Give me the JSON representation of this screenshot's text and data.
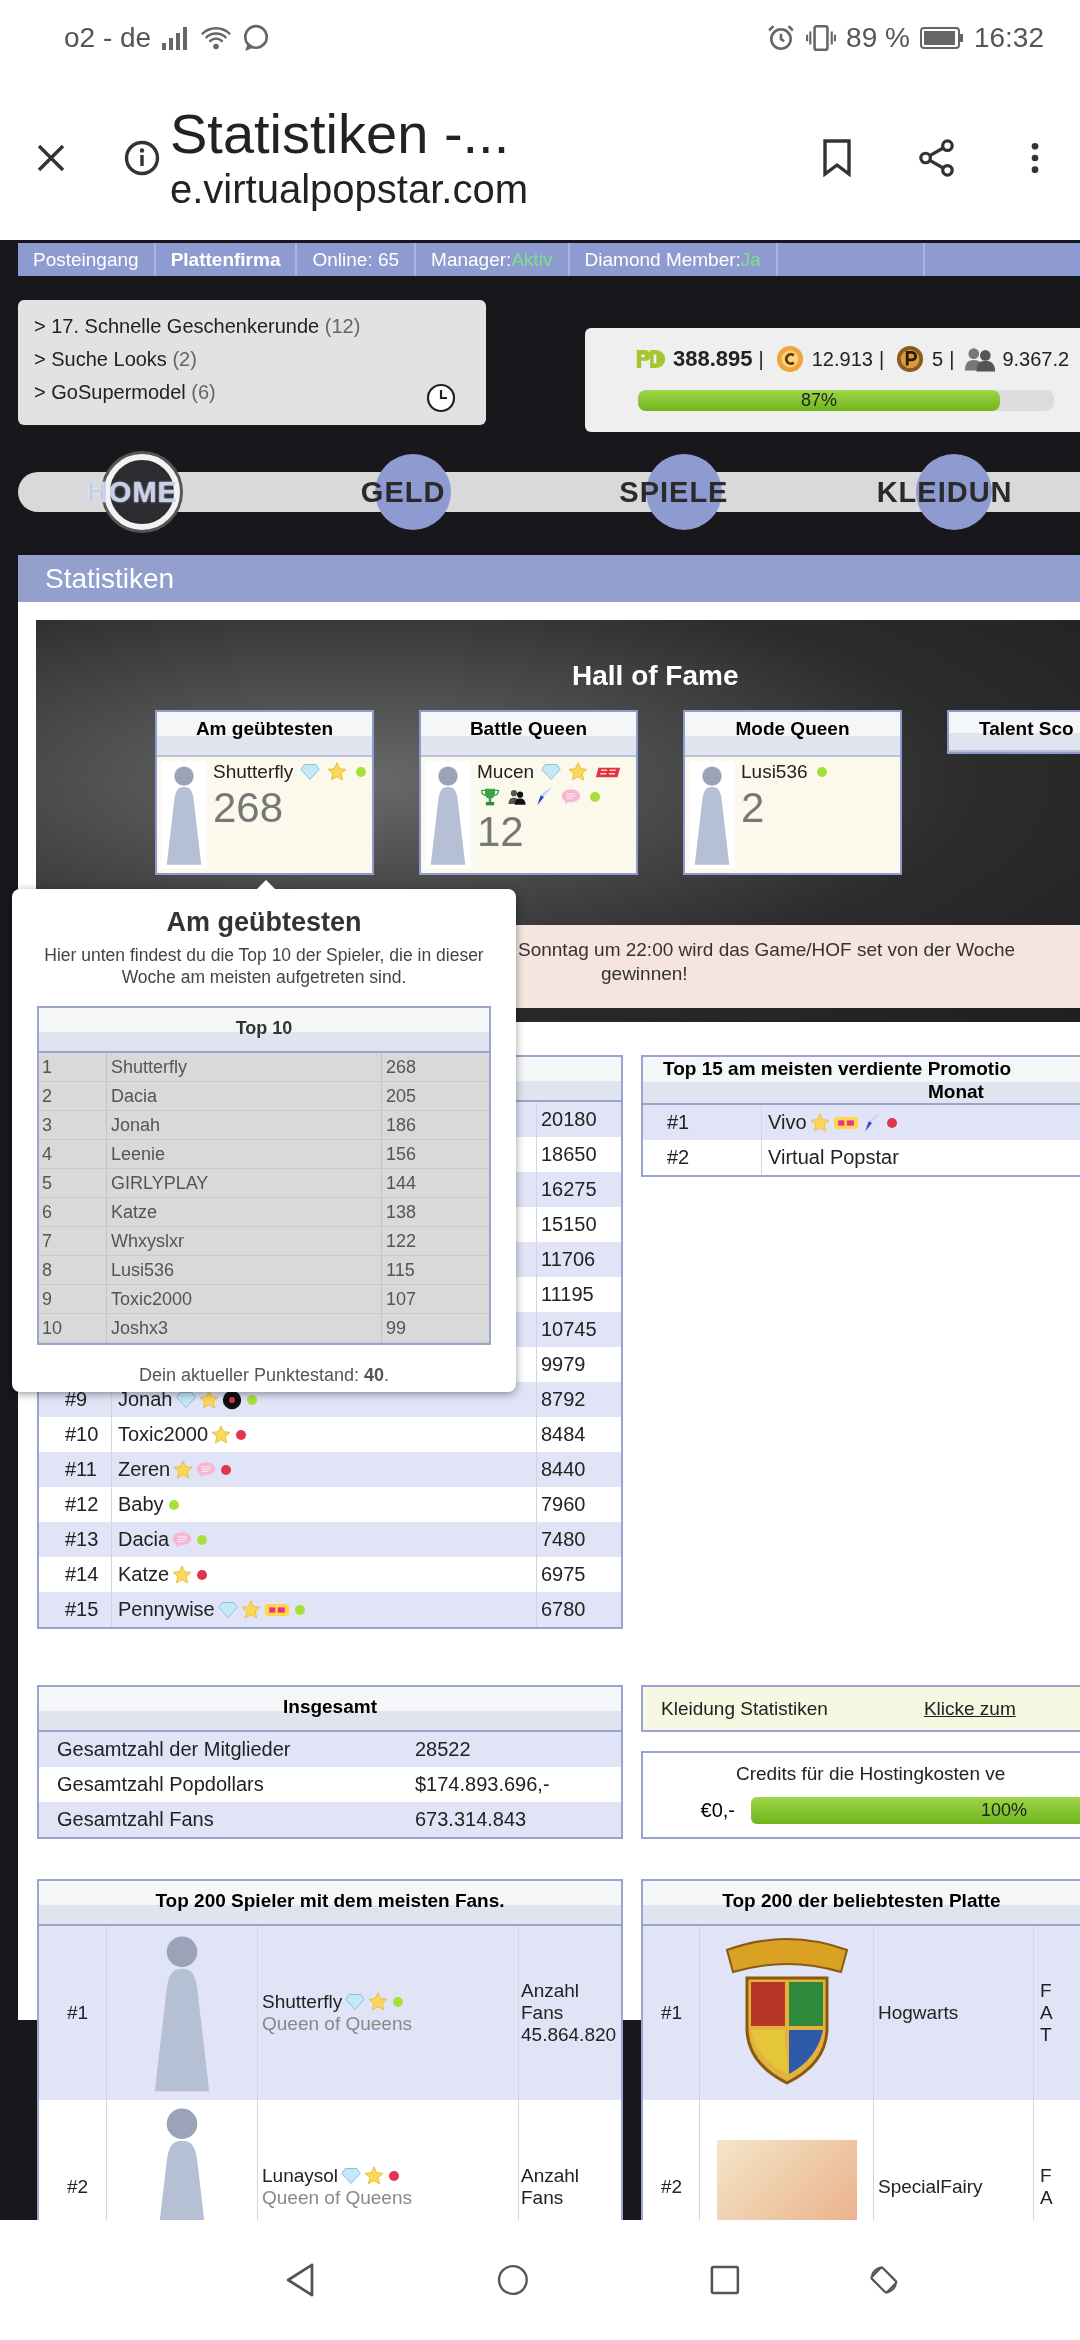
{
  "status_bar": {
    "carrier": "o2 - de",
    "battery": "89 %",
    "time": "16:32"
  },
  "browser": {
    "title": "Statistiken -...",
    "url": "e.virtualpopstar.com"
  },
  "top_nav": [
    {
      "label": "Posteingang",
      "selected": false
    },
    {
      "label": "Plattenfirma",
      "selected": true
    },
    {
      "label": "Online: 65",
      "selected": false
    },
    {
      "label": "Manager:",
      "value": "Aktiv",
      "selected": false
    },
    {
      "label": "Diamond Member:",
      "value": "Ja",
      "selected": false
    }
  ],
  "notifications": [
    {
      "label": "> 17. Schnelle Geschenkerunde",
      "count": "(12)"
    },
    {
      "label": "> Suche Looks",
      "count": "(2)"
    },
    {
      "label": "> GoSupermodel",
      "count": "(6)"
    }
  ],
  "balance": {
    "items": [
      {
        "kind": "popdollars",
        "value": "388.895",
        "separator": "|"
      },
      {
        "kind": "coins",
        "value": "12.913",
        "separator": "|"
      },
      {
        "kind": "points",
        "value": "5",
        "separator": "|"
      },
      {
        "kind": "fans",
        "value": "9.367.2"
      }
    ],
    "level": 0.87,
    "label": "87%"
  },
  "menu": [
    {
      "label": "HOME",
      "selected": true
    },
    {
      "label": "GELD",
      "selected": false
    },
    {
      "label": "SPIELE",
      "selected": false
    },
    {
      "label": "KLEIDUN",
      "selected": false
    }
  ],
  "section_title": "Statistiken",
  "hall_of_fame": {
    "title": "Hall of Fame",
    "cards": [
      {
        "title": "Am geübtesten",
        "player": "Shutterfly",
        "badges": [
          {
            "kind": "diamond"
          },
          {
            "kind": "star"
          }
        ],
        "color": "#a8e03a",
        "score": "268"
      },
      {
        "title": "Battle Queen",
        "player": "Mucen",
        "badges": [
          {
            "kind": "diamond"
          },
          {
            "kind": "star"
          },
          {
            "kind": "nt"
          },
          {
            "kind": "trophy"
          },
          {
            "kind": "team"
          },
          {
            "kind": "quill"
          },
          {
            "kind": "chat"
          }
        ],
        "color": "#a8e03a",
        "score": "12"
      },
      {
        "title": "Mode Queen",
        "player": "Lusi536",
        "color": "#a8e03a",
        "score": "2"
      },
      {
        "title": "Talent Sco"
      }
    ],
    "notice": [
      "Sonntag um 22:00 wird das Game/HOF set von der Woche",
      "gewinnen!"
    ]
  },
  "tooltip": {
    "title": "Am geübtesten",
    "description": "Hier unten findest du die Top 10 der Spieler, die in dieser Woche am meisten aufgetreten sind.",
    "table_title": "Top 10",
    "rows": [
      {
        "rank": "1",
        "name": "Shutterfly",
        "score": "268"
      },
      {
        "rank": "2",
        "name": "Dacia",
        "score": "205"
      },
      {
        "rank": "3",
        "name": "Jonah",
        "score": "186"
      },
      {
        "rank": "4",
        "name": "Leenie",
        "score": "156"
      },
      {
        "rank": "5",
        "name": "GIRLYPLAY",
        "score": "144"
      },
      {
        "rank": "6",
        "name": "Katze",
        "score": "138"
      },
      {
        "rank": "7",
        "name": "Whxyslxr",
        "score": "122"
      },
      {
        "rank": "8",
        "name": "Lusi536",
        "score": "115"
      },
      {
        "rank": "9",
        "name": "Toxic2000",
        "score": "107"
      },
      {
        "rank": "10",
        "name": "Joshx3",
        "score": "99"
      }
    ],
    "footer": "Dein aktueller Punktestand: **40**."
  },
  "weekly_ranking": {
    "rows": [
      {
        "value": "20180"
      },
      {
        "value": "18650"
      },
      {
        "value": "16275"
      },
      {
        "value": "15150"
      },
      {
        "value": "11706"
      },
      {
        "value": "11195"
      },
      {
        "value": "10745"
      },
      {
        "value": "9979"
      },
      {
        "rank": "#9",
        "name": "Jonah",
        "badges": [
          {
            "kind": "diamond"
          },
          {
            "kind": "star"
          },
          {
            "kind": "record"
          }
        ],
        "color": "#a8e03a",
        "value": "8792"
      },
      {
        "rank": "#10",
        "name": "Toxic2000",
        "badges": [
          {
            "kind": "star"
          }
        ],
        "color": "#e0344f",
        "value": "8484"
      },
      {
        "rank": "#11",
        "name": "Zeren",
        "badges": [
          {
            "kind": "star"
          },
          {
            "kind": "chat"
          }
        ],
        "color": "#e0344f",
        "value": "8440"
      },
      {
        "rank": "#12",
        "name": "Baby",
        "color": "#a8e03a",
        "value": "7960"
      },
      {
        "rank": "#13",
        "name": "Dacia",
        "badges": [
          {
            "kind": "chat"
          }
        ],
        "color": "#a8e03a",
        "value": "7480"
      },
      {
        "rank": "#14",
        "name": "Katze",
        "badges": [
          {
            "kind": "star"
          }
        ],
        "color": "#e0344f",
        "value": "6975"
      },
      {
        "rank": "#15",
        "name": "Pennywise",
        "badges": [
          {
            "kind": "diamond"
          },
          {
            "kind": "star"
          },
          {
            "kind": "pt"
          }
        ],
        "color": "#a8e03a",
        "value": "6780"
      }
    ]
  },
  "promotion_ranking": {
    "title_lines": [
      "Top 15 am meisten verdiente Promotio",
      "Monat"
    ],
    "rows": [
      {
        "rank": "#1",
        "name": "Vivo",
        "badges": [
          {
            "kind": "star"
          },
          {
            "kind": "pt"
          },
          {
            "kind": "quill"
          }
        ],
        "color": "#e0344f"
      },
      {
        "rank": "#2",
        "name": "Virtual Popstar"
      }
    ]
  },
  "totals": {
    "title": "Insgesamt",
    "rows": [
      {
        "label": "Gesamtzahl der Mitglieder",
        "value": "28522"
      },
      {
        "label": "Gesamtzahl Popdollars",
        "value": "$174.893.696,-"
      },
      {
        "label": "Gesamtzahl Fans",
        "value": "673.314.843"
      }
    ]
  },
  "clothing_stats": {
    "label": "Kleidung Statistiken",
    "link": "Klicke zum"
  },
  "hosting": {
    "title": "Credits für die Hostingkosten ve",
    "amount": "€0,-",
    "level": 1,
    "label": "100%"
  },
  "top_players": {
    "title": "Top 200 Spieler mit dem meisten Fans.",
    "rows": [
      {
        "rank": "#1",
        "name": "Shutterfly",
        "badges": [
          {
            "kind": "diamond"
          },
          {
            "kind": "star"
          }
        ],
        "color": "#a8e03a",
        "rank_title": "Queen of Queens",
        "fans_label": "Anzahl Fans",
        "fans": "45.864.820"
      },
      {
        "rank": "#2",
        "name": "Lunaysol",
        "badges": [
          {
            "kind": "diamond"
          },
          {
            "kind": "star"
          }
        ],
        "color": "#e0344f",
        "rank_title": "Queen of Queens",
        "fans_label": "Anzahl Fans"
      }
    ]
  },
  "top_labels": {
    "title": "Top 200 der beliebtesten Platte",
    "rows": [
      {
        "rank": "#1",
        "kind": "crest",
        "name": "Hogwarts",
        "column_4": [
          "F",
          "A",
          "T"
        ]
      },
      {
        "rank": "#2",
        "kind": "photo",
        "name": "SpecialFairy",
        "column_4": [
          "F",
          "A"
        ]
      }
    ]
  }
}
